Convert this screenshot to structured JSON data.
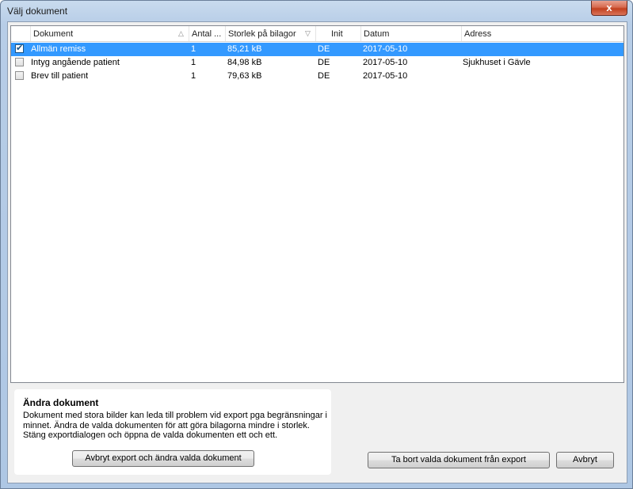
{
  "window": {
    "title": "Välj dokument",
    "close_glyph": "x"
  },
  "columns": [
    {
      "label": "Dokument",
      "sort": "△"
    },
    {
      "label": "Antal ...",
      "sort": ""
    },
    {
      "label": "Storlek på bilagor",
      "sort": "▽"
    },
    {
      "label": "Init",
      "sort": ""
    },
    {
      "label": "Datum",
      "sort": ""
    },
    {
      "label": "Adress",
      "sort": ""
    }
  ],
  "rows": [
    {
      "checked": true,
      "selected": true,
      "name": "Allmän remiss",
      "count": "1",
      "size": "85,21 kB",
      "init": "DE",
      "date": "2017-05-10",
      "address": ""
    },
    {
      "checked": false,
      "selected": false,
      "name": "Intyg angående patient",
      "count": "1",
      "size": "84,98 kB",
      "init": "DE",
      "date": "2017-05-10",
      "address": "Sjukhuset i Gävle"
    },
    {
      "checked": false,
      "selected": false,
      "name": "Brev till patient",
      "count": "1",
      "size": "79,63 kB",
      "init": "DE",
      "date": "2017-05-10",
      "address": ""
    }
  ],
  "info_panel": {
    "title": "Ändra dokument",
    "line1": "Dokument med stora bilder kan leda till problem vid export pga begränsningar i",
    "line2": "minnet. Ändra de valda dokumenten för att göra bilagorna mindre i storlek.",
    "line3": "Stäng exportdialogen och öppna de valda dokumenten ett och ett."
  },
  "buttons": {
    "edit": "Avbryt export och ändra valda dokument",
    "remove": "Ta bort valda dokument från export",
    "cancel": "Avbryt"
  }
}
